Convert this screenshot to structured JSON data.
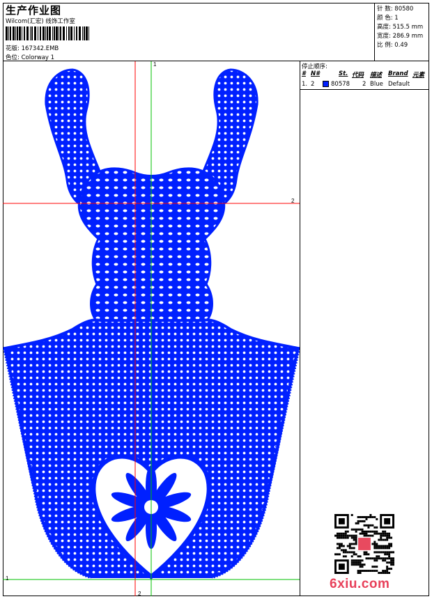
{
  "header": {
    "title": "生产作业图",
    "subtitle": "Wilcom(汇宏) 线饰工作室",
    "design_file_label": "花版:",
    "design_file": "167342.EMB",
    "colorway_label": "色位:",
    "colorway": "Colorway 1"
  },
  "stats": [
    {
      "label": "针 数:",
      "value": "80580"
    },
    {
      "label": "颜 色:",
      "value": "1"
    },
    {
      "label": "高度:",
      "value": "515.5 mm"
    },
    {
      "label": "宽度:",
      "value": "286.9 mm"
    },
    {
      "label": "比 例:",
      "value": "0.49"
    }
  ],
  "stop_sequence": {
    "heading": "停止顺序:",
    "columns": [
      "#",
      "N#",
      "St.",
      "代码",
      "描述",
      "Brand",
      "元素"
    ],
    "rows": [
      {
        "idx": "1.",
        "n": "2",
        "st": "80578",
        "code": "2",
        "desc": "Blue",
        "brand": "Default",
        "element": ""
      }
    ]
  },
  "guides": {
    "label_1": "1",
    "label_2": "2"
  },
  "watermark": "6xiu.com",
  "colors": {
    "thread": "#0020ff",
    "guide_red": "#ff0000",
    "guide_green": "#00c000"
  }
}
